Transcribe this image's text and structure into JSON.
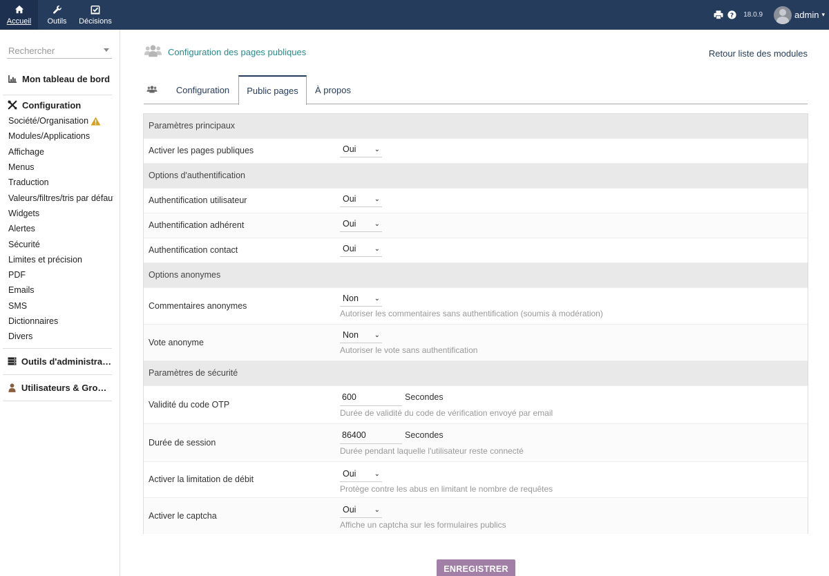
{
  "topnav": {
    "items": [
      {
        "label": "Accueil",
        "icon": "home-icon",
        "active": true
      },
      {
        "label": "Outils",
        "icon": "wrench-icon"
      },
      {
        "label": "Décisions",
        "icon": "checkbox-icon"
      }
    ]
  },
  "topright": {
    "version": "18.0.9",
    "user": "admin"
  },
  "sidebar": {
    "search_placeholder": "Rechercher",
    "dashboard": "Mon tableau de bord",
    "config_title": "Configuration",
    "config_items": [
      "Société/Organisation",
      "Modules/Applications",
      "Affichage",
      "Menus",
      "Traduction",
      "Valeurs/filtres/tris par défaut",
      "Widgets",
      "Alertes",
      "Sécurité",
      "Limites et précision",
      "PDF",
      "Emails",
      "SMS",
      "Dictionnaires",
      "Divers"
    ],
    "admin_tools": "Outils d'administration",
    "users_groups": "Utilisateurs & Groupes"
  },
  "page": {
    "title": "Configuration des pages publiques",
    "back_link": "Retour liste des modules"
  },
  "tabs": {
    "config": "Configuration",
    "public": "Public pages",
    "about": "À propos"
  },
  "settings": {
    "main_section": "Paramètres principaux",
    "enable_public": {
      "label": "Activer les pages publiques",
      "value": "Oui"
    },
    "auth_section": "Options d'authentification",
    "auth_user": {
      "label": "Authentification utilisateur",
      "value": "Oui"
    },
    "auth_member": {
      "label": "Authentification adhérent",
      "value": "Oui"
    },
    "auth_contact": {
      "label": "Authentification contact",
      "value": "Oui"
    },
    "anon_section": "Options anonymes",
    "anon_comments": {
      "label": "Commentaires anonymes",
      "value": "Non",
      "hint": "Autoriser les commentaires sans authentification (soumis à modération)"
    },
    "anon_vote": {
      "label": "Vote anonyme",
      "value": "Non",
      "hint": "Autoriser le vote sans authentification"
    },
    "security_section": "Paramètres de sécurité",
    "otp": {
      "label": "Validité du code OTP",
      "value": "600",
      "unit": "Secondes",
      "hint": "Durée de validité du code de vérification envoyé par email"
    },
    "session": {
      "label": "Durée de session",
      "value": "86400",
      "unit": "Secondes",
      "hint": "Durée pendant laquelle l'utilisateur reste connecté"
    },
    "rate_limit": {
      "label": "Activer la limitation de débit",
      "value": "Oui",
      "hint": "Protège contre les abus en limitant le nombre de requêtes"
    },
    "captcha": {
      "label": "Activer le captcha",
      "value": "Oui",
      "hint": "Affiche un captcha sur les formulaires publics"
    }
  },
  "save_label": "ENREGISTRER"
}
